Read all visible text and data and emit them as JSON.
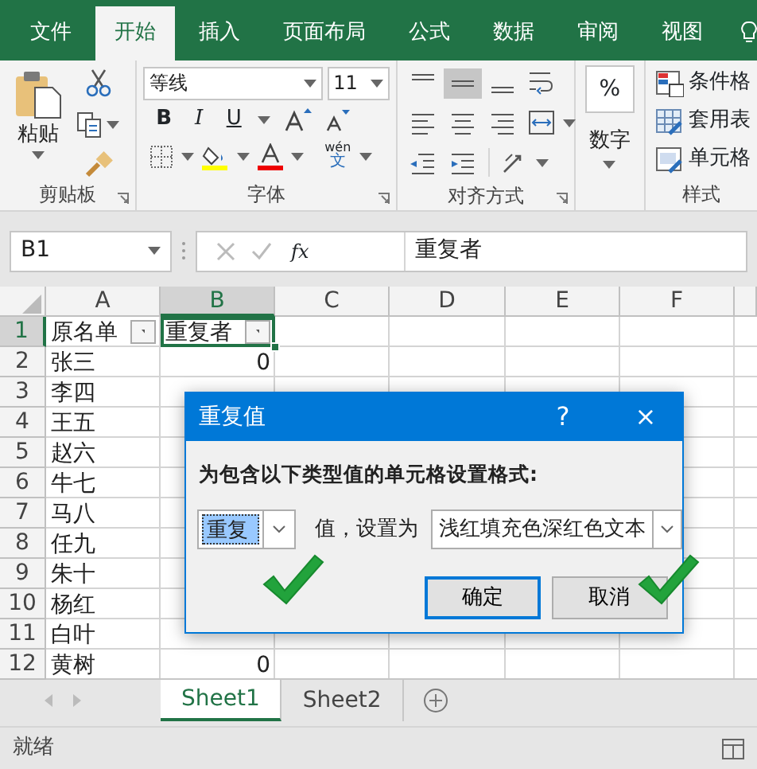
{
  "ribbon_tabs": [
    {
      "label": "文件",
      "selected": false
    },
    {
      "label": "开始",
      "selected": true
    },
    {
      "label": "插入",
      "selected": false
    },
    {
      "label": "页面布局",
      "selected": false
    },
    {
      "label": "公式",
      "selected": false
    },
    {
      "label": "数据",
      "selected": false
    },
    {
      "label": "审阅",
      "selected": false
    },
    {
      "label": "视图",
      "selected": false
    }
  ],
  "clipboard": {
    "paste": "粘贴",
    "group": "剪贴板"
  },
  "font": {
    "name": "等线",
    "size": "11",
    "bold": "B",
    "italic": "I",
    "underline": "U",
    "phonetic_top": "wén",
    "phonetic_bottom": "文",
    "group": "字体"
  },
  "alignment": {
    "group": "对齐方式"
  },
  "number": {
    "symbol": "%",
    "label": "数字"
  },
  "styles": {
    "items": [
      "条件格",
      "套用表",
      "单元格"
    ],
    "group": "样式"
  },
  "formula_bar": {
    "name_box": "B1",
    "fx": "fx",
    "value": "重复者"
  },
  "columns": [
    "A",
    "B",
    "C",
    "D",
    "E",
    "F"
  ],
  "rows": [
    {
      "number": "1",
      "cells": [
        {
          "text": "原名单",
          "kind": "filter",
          "selected": false
        },
        {
          "text": "重复者",
          "kind": "filter",
          "selected": true
        }
      ]
    },
    {
      "number": "2",
      "cells": [
        {
          "text": "张三",
          "kind": "text",
          "selected": false
        },
        {
          "text": "0",
          "kind": "number",
          "selected": false
        }
      ]
    },
    {
      "number": "3",
      "cells": [
        {
          "text": "李四",
          "kind": "text",
          "selected": false
        }
      ]
    },
    {
      "number": "4",
      "cells": [
        {
          "text": "王五",
          "kind": "text",
          "selected": false
        }
      ]
    },
    {
      "number": "5",
      "cells": [
        {
          "text": "赵六",
          "kind": "text",
          "selected": false
        }
      ]
    },
    {
      "number": "6",
      "cells": [
        {
          "text": "牛七",
          "kind": "text",
          "selected": false
        }
      ]
    },
    {
      "number": "7",
      "cells": [
        {
          "text": "马八",
          "kind": "text",
          "selected": false
        }
      ]
    },
    {
      "number": "8",
      "cells": [
        {
          "text": "任九",
          "kind": "text",
          "selected": false
        }
      ]
    },
    {
      "number": "9",
      "cells": [
        {
          "text": "朱十",
          "kind": "text",
          "selected": false
        }
      ]
    },
    {
      "number": "10",
      "cells": [
        {
          "text": "杨红",
          "kind": "text",
          "selected": false
        }
      ]
    },
    {
      "number": "11",
      "cells": [
        {
          "text": "白叶",
          "kind": "text",
          "selected": false
        }
      ]
    },
    {
      "number": "12",
      "cells": [
        {
          "text": "黄树",
          "kind": "text",
          "selected": false
        },
        {
          "text": "0",
          "kind": "number",
          "selected": false
        }
      ]
    }
  ],
  "sheet_tabs": [
    {
      "label": "Sheet1",
      "selected": true
    },
    {
      "label": "Sheet2",
      "selected": false
    }
  ],
  "status": "就绪",
  "dialog": {
    "title": "重复值",
    "help": "?",
    "close": "×",
    "prompt": "为包含以下类型值的单元格设置格式:",
    "type_value": "重复",
    "between": "值，设置为",
    "format_value": "浅红填充色深红色文本",
    "buttons": [
      {
        "label": "确定",
        "selected": true
      },
      {
        "label": "取消",
        "selected": false
      }
    ]
  }
}
